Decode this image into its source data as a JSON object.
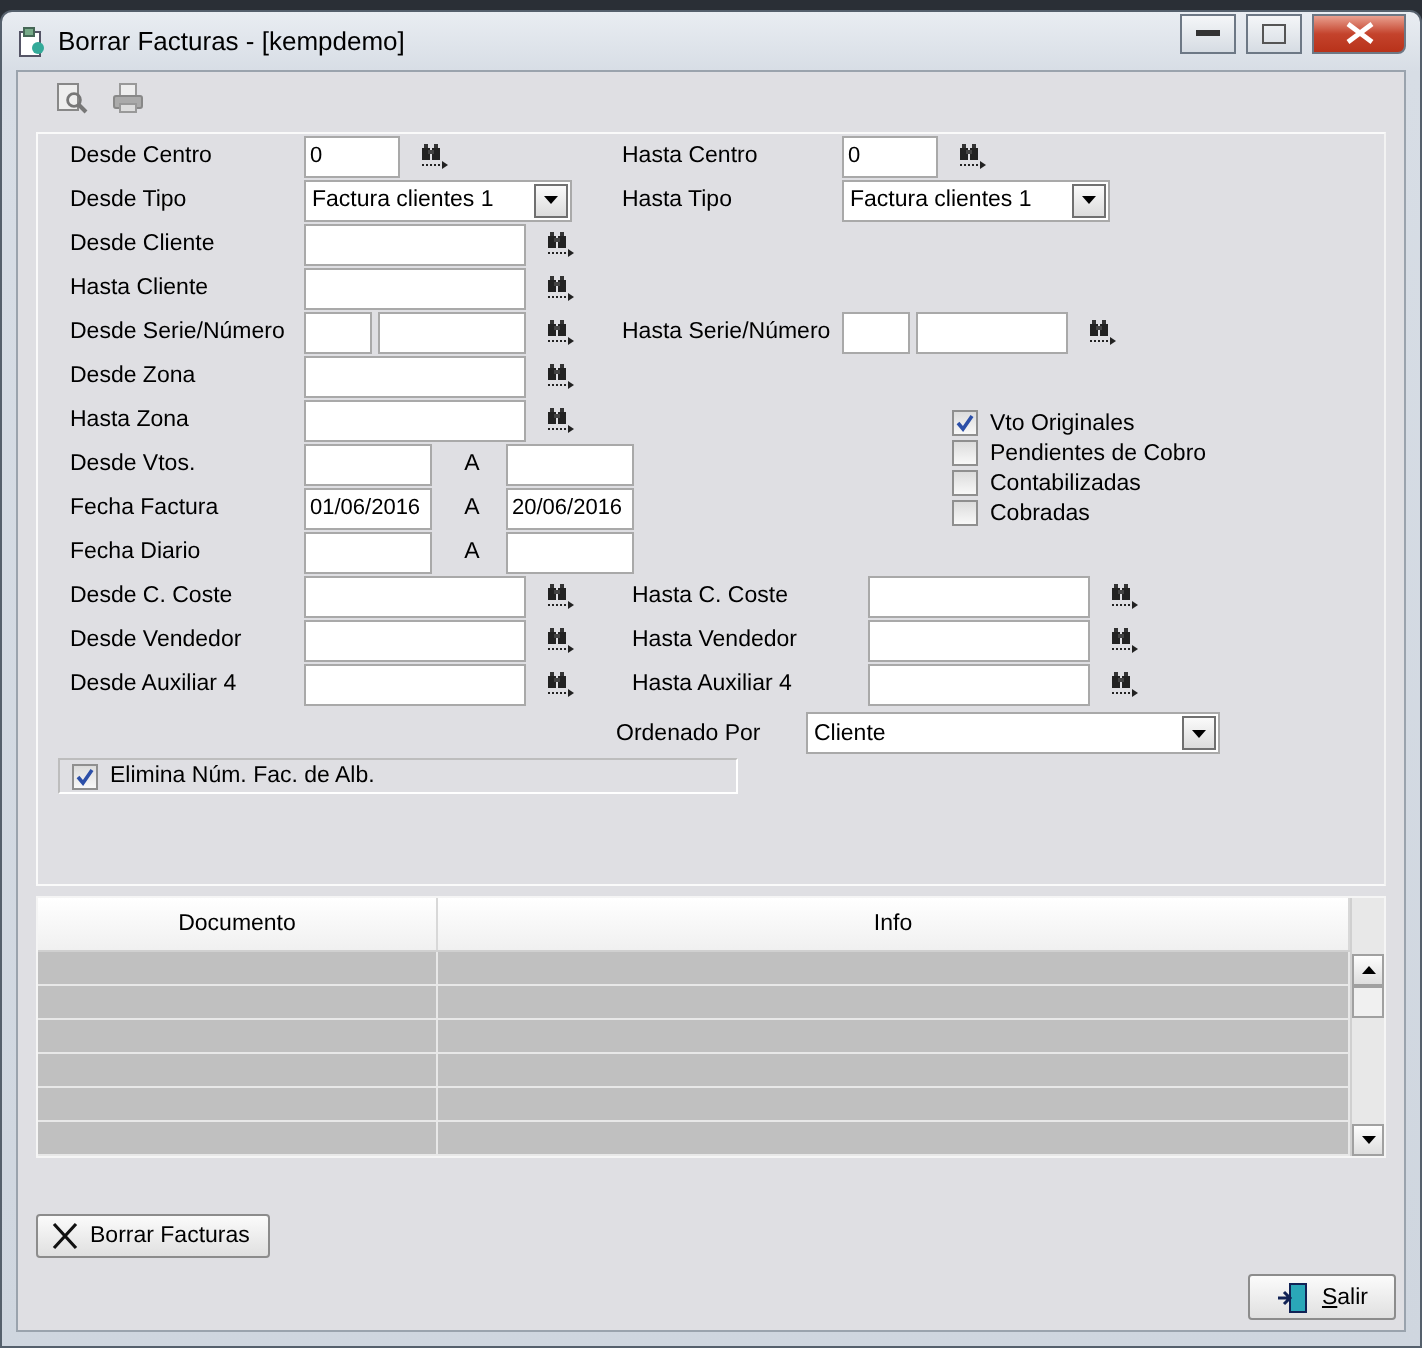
{
  "window": {
    "title": "Borrar Facturas - [kempdemo]"
  },
  "rows": [
    {
      "left": {
        "label": "Desde Centro",
        "kind": "short",
        "values": [
          "0"
        ]
      },
      "right": {
        "label": "Hasta Centro",
        "kind": "short",
        "values": [
          "0"
        ]
      }
    },
    {
      "left": {
        "label": "Desde Tipo",
        "kind": "select",
        "values": [
          "Factura clientes 1"
        ]
      },
      "right": {
        "label": "Hasta Tipo",
        "kind": "select",
        "values": [
          "Factura clientes 1"
        ]
      }
    },
    {
      "left": {
        "label": "Desde Cliente",
        "kind": "lookup"
      }
    },
    {
      "left": {
        "label": "Hasta Cliente",
        "kind": "lookup"
      }
    },
    {
      "left": {
        "label": "Desde Serie/Número",
        "kind": "pair"
      },
      "right": {
        "label": "Hasta Serie/Número",
        "kind": "pair"
      }
    },
    {
      "left": {
        "label": "Desde Zona",
        "kind": "lookup"
      }
    },
    {
      "left": {
        "label": "Hasta Zona",
        "kind": "lookup"
      }
    },
    {
      "left": {
        "label": "Desde Vtos.",
        "kind": "range",
        "separator": "A"
      }
    },
    {
      "left": {
        "label": "Fecha Factura",
        "kind": "range",
        "separator": "A",
        "values": [
          "01/06/2016",
          "20/06/2016"
        ]
      }
    },
    {
      "left": {
        "label": "Fecha Diario",
        "kind": "range",
        "separator": "A"
      }
    },
    {
      "left": {
        "label": "Desde C. Coste",
        "kind": "lookup"
      },
      "right": {
        "label": "Hasta C. Coste",
        "kind": "lookup"
      }
    },
    {
      "left": {
        "label": "Desde Vendedor",
        "kind": "lookup"
      },
      "right": {
        "label": "Hasta Vendedor",
        "kind": "lookup"
      }
    },
    {
      "left": {
        "label": "Desde Auxiliar 4",
        "kind": "lookup"
      },
      "right": {
        "label": "Hasta Auxiliar 4",
        "kind": "lookup"
      }
    }
  ],
  "options": [
    {
      "label": "Vto Originales",
      "checked": true
    },
    {
      "label": "Pendientes de Cobro",
      "checked": false
    },
    {
      "label": "Contabilizadas",
      "checked": false
    },
    {
      "label": "Cobradas",
      "checked": false
    }
  ],
  "order": {
    "label": "Ordenado Por",
    "value": "Cliente"
  },
  "remove_numbers": {
    "label": "Elimina Núm. Fac. de Alb.",
    "checked": true
  },
  "table": {
    "columns": [
      "Documento",
      "Info"
    ]
  },
  "buttons": {
    "delete": "Borrar Facturas",
    "exit": "Salir"
  }
}
